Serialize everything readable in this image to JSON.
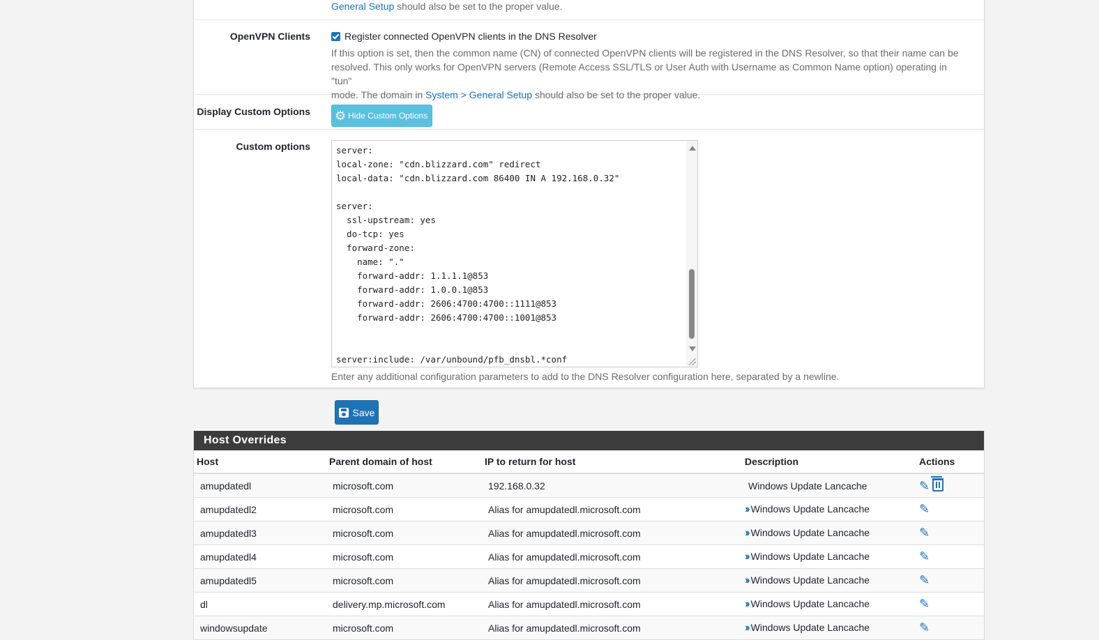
{
  "top_fragment": {
    "link": "General Setup",
    "rest": " should also be set to the proper value."
  },
  "openvpn": {
    "label": "OpenVPN Clients",
    "checkbox_label": "Register connected OpenVPN clients in the DNS Resolver",
    "help_line1": "If this option is set, then the common name (CN) of connected OpenVPN clients will be registered in the DNS Resolver, so that their name can be",
    "help_line2": "resolved. This only works for OpenVPN servers (Remote Access SSL/TLS or User Auth with Username as Common Name option) operating in \"tun\"",
    "help_line3_prefix": "mode. The domain in ",
    "help_link": "System > General Setup",
    "help_line3_suffix": " should also be set to the proper value."
  },
  "display_custom": {
    "label": "Display Custom Options",
    "button": "Hide Custom Options"
  },
  "custom_options": {
    "label": "Custom options",
    "value": "server:\nlocal-zone: \"cdn.blizzard.com\" redirect\nlocal-data: \"cdn.blizzard.com 86400 IN A 192.168.0.32\"\n\nserver:\n  ssl-upstream: yes\n  do-tcp: yes\n  forward-zone:\n    name: \".\"\n    forward-addr: 1.1.1.1@853\n    forward-addr: 1.0.0.1@853\n    forward-addr: 2606:4700:4700::1111@853\n    forward-addr: 2606:4700:4700::1001@853\n\n\nserver:include: /var/unbound/pfb_dnsbl.*conf",
    "help": "Enter any additional configuration parameters to add to the DNS Resolver configuration here, separated by a newline."
  },
  "save_label": "Save",
  "host_overrides": {
    "title": "Host Overrides",
    "columns": {
      "host": "Host",
      "parent": "Parent domain of host",
      "ip": "IP to return for host",
      "desc": "Description",
      "actions": "Actions"
    },
    "rows": [
      {
        "host": "amupdatedl",
        "parent": "microsoft.com",
        "ip": "192.168.0.32",
        "desc": "Windows Update Lancache"
      },
      {
        "host": "amupdatedl2",
        "parent": "microsoft.com",
        "ip": "Alias for amupdatedl.microsoft.com",
        "desc": "Windows Update Lancache"
      },
      {
        "host": "amupdatedl3",
        "parent": "microsoft.com",
        "ip": "Alias for amupdatedl.microsoft.com",
        "desc": "Windows Update Lancache"
      },
      {
        "host": "amupdatedl4",
        "parent": "microsoft.com",
        "ip": "Alias for amupdatedl.microsoft.com",
        "desc": "Windows Update Lancache"
      },
      {
        "host": "amupdatedl5",
        "parent": "microsoft.com",
        "ip": "Alias for amupdatedl.microsoft.com",
        "desc": "Windows Update Lancache"
      },
      {
        "host": "dl",
        "parent": "delivery.mp.microsoft.com",
        "ip": "Alias for amupdatedl.microsoft.com",
        "desc": "Windows Update Lancache"
      },
      {
        "host": "windowsupdate",
        "parent": "microsoft.com",
        "ip": "Alias for amupdatedl.microsoft.com",
        "desc": "Windows Update Lancache"
      }
    ]
  }
}
